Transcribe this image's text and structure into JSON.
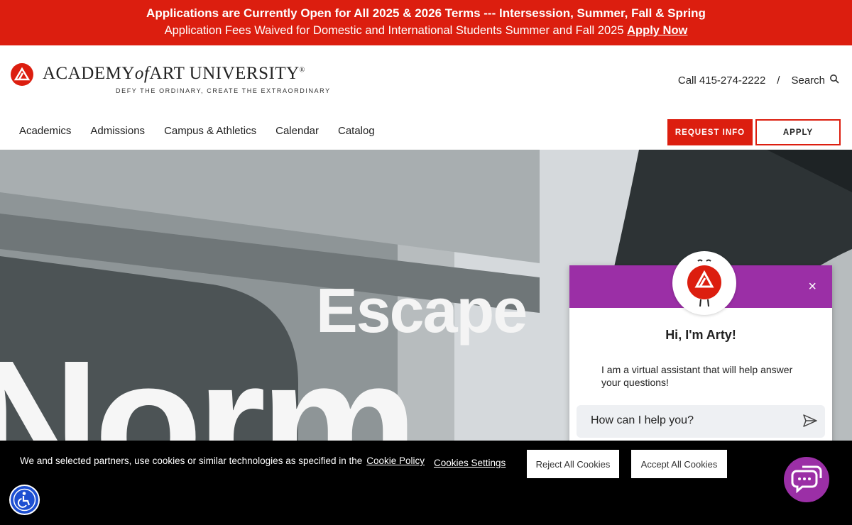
{
  "banner": {
    "line1": "Applications are Currently Open for All 2025 & 2026 Terms --- Intersession, Summer, Fall & Spring",
    "line2": "Application Fees Waived for Domestic and International Students Summer and Fall 2025",
    "link": "Apply Now"
  },
  "header": {
    "logo_part1": "ACADEMY",
    "logo_of": "of",
    "logo_part2": "ART UNIVERSITY",
    "logo_reg": "®",
    "tagline": "DEFY THE ORDINARY, CREATE THE EXTRAORDINARY",
    "call": "Call 415-274-2222",
    "separator": "/",
    "search": "Search"
  },
  "nav": {
    "items": [
      "Academics",
      "Admissions",
      "Campus & Athletics",
      "Calendar",
      "Catalog"
    ],
    "request_info": "REQUEST INFO",
    "apply": "APPLY"
  },
  "hero": {
    "word": "Escape",
    "big": "Norm"
  },
  "chat": {
    "title": "Hi, I'm Arty!",
    "body": "I am a virtual assistant that will help answer your questions!",
    "placeholder": "How can I help you?",
    "close": "×"
  },
  "cookie": {
    "message": "We and selected partners, use cookies or similar technologies as specified in the",
    "policy_link": "Cookie Policy",
    "settings": "Cookies Settings",
    "reject": "Reject All Cookies",
    "accept": "Accept All Cookies"
  },
  "colors": {
    "brand_red": "#dc1e0f",
    "chat_purple": "#9b2fa6",
    "a11y_blue": "#1d4fd1"
  }
}
